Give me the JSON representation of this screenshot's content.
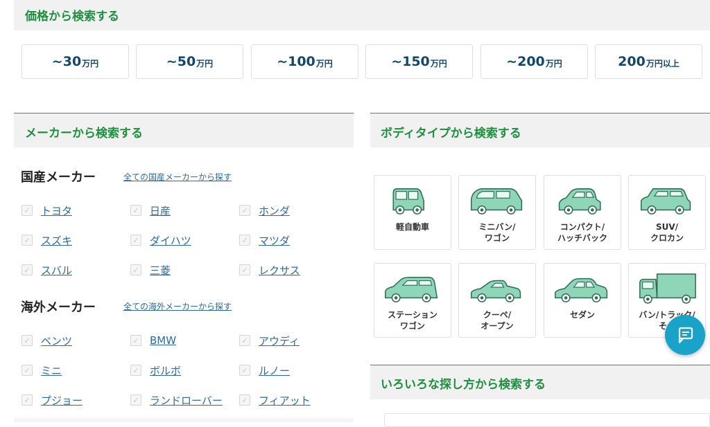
{
  "price_section": {
    "title": "価格から検索する",
    "buttons": [
      {
        "prefix": "~",
        "amount": "30",
        "unit": "万円"
      },
      {
        "prefix": "~",
        "amount": "50",
        "unit": "万円"
      },
      {
        "prefix": "~",
        "amount": "100",
        "unit": "万円"
      },
      {
        "prefix": "~",
        "amount": "150",
        "unit": "万円"
      },
      {
        "prefix": "~",
        "amount": "200",
        "unit": "万円"
      },
      {
        "prefix": "",
        "amount": "200",
        "unit": "万円以上"
      }
    ]
  },
  "maker_section": {
    "title": "メーカーから検索する",
    "domestic": {
      "heading": "国産メーカー",
      "link": "全ての国産メーカーから探す",
      "makers": [
        "トヨタ",
        "日産",
        "ホンダ",
        "スズキ",
        "ダイハツ",
        "マツダ",
        "スバル",
        "三菱",
        "レクサス"
      ]
    },
    "foreign": {
      "heading": "海外メーカー",
      "link": "全ての海外メーカーから探す",
      "makers": [
        "ベンツ",
        "BMW",
        "アウディ",
        "ミニ",
        "ボルボ",
        "ルノー",
        "プジョー",
        "ランドローバー",
        "フィアット"
      ]
    }
  },
  "body_section": {
    "title": "ボディタイプから検索する",
    "types": [
      {
        "label": "軽自動車",
        "icon": "kei-car-icon"
      },
      {
        "label": "ミニバン/\nワゴン",
        "icon": "minivan-icon"
      },
      {
        "label": "コンパクト/\nハッチバック",
        "icon": "compact-car-icon"
      },
      {
        "label": "SUV/\nクロカン",
        "icon": "suv-icon"
      },
      {
        "label": "ステーション\nワゴン",
        "icon": "station-wagon-icon"
      },
      {
        "label": "クーペ/\nオープン",
        "icon": "coupe-icon"
      },
      {
        "label": "セダン",
        "icon": "sedan-icon"
      },
      {
        "label": "バン/トラック/\nその",
        "icon": "truck-icon"
      }
    ]
  },
  "other_section": {
    "title": "いろいろな探し方から検索する"
  },
  "chat": {
    "icon": "chat-icon"
  },
  "colors": {
    "accent_green": "#1e8f3f",
    "link_blue": "#2b6aa0",
    "price_text": "#14466b",
    "car_fill": "#8fd6b8",
    "chat_bg": "#1aa3c8"
  }
}
